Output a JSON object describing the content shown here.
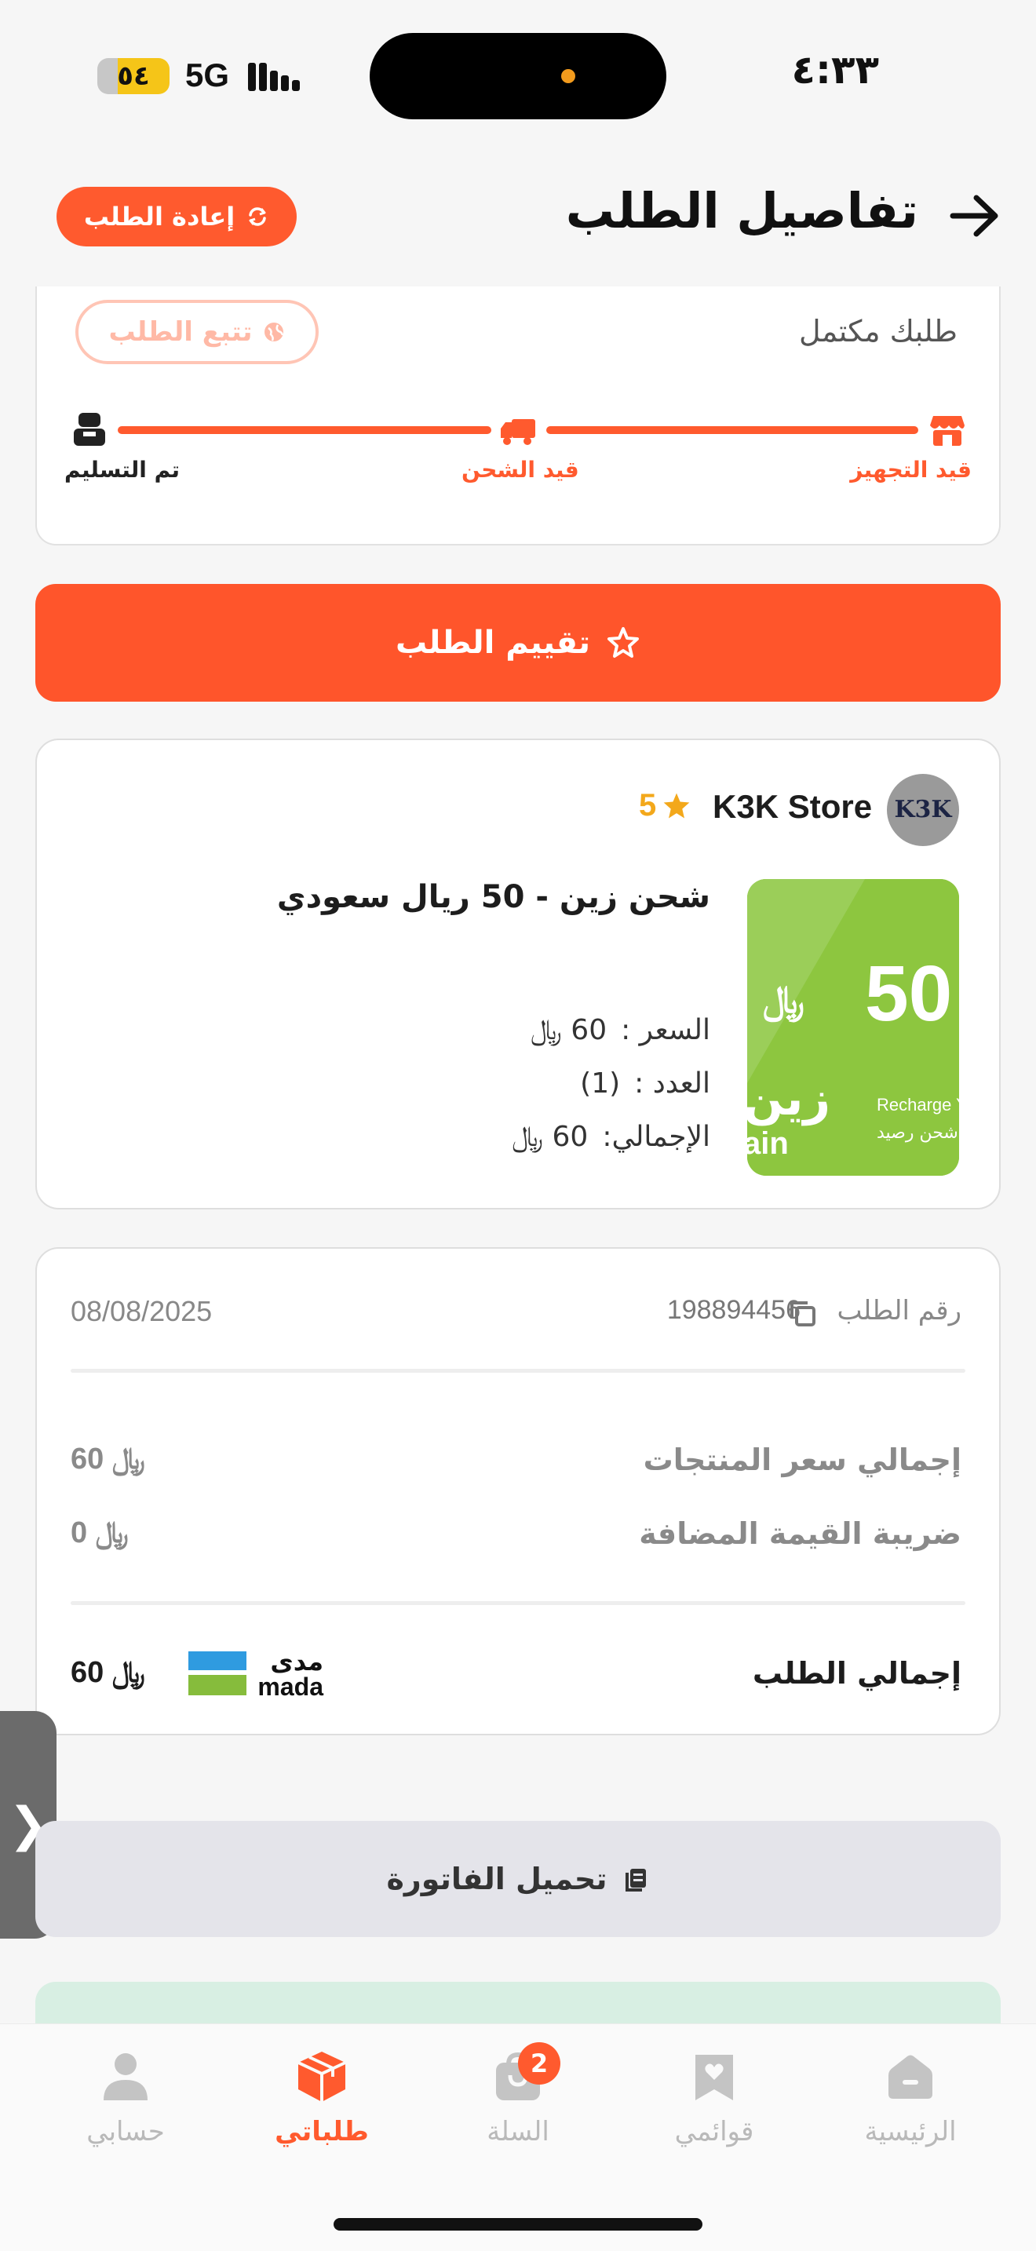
{
  "status_bar": {
    "time": "٤:٣٣",
    "network": "5G",
    "battery": "٥٤"
  },
  "header": {
    "title": "تفاصيل الطلب",
    "reorder_label": "إعادة الطلب"
  },
  "order_status": {
    "text": "طلبك مكتمل",
    "track_label": "تتبع الطلب",
    "steps": [
      {
        "label": "قيد التجهيز",
        "icon": "store-icon"
      },
      {
        "label": "قيد الشحن",
        "icon": "truck-icon"
      },
      {
        "label": "تم التسليم",
        "icon": "delivery-person-icon"
      }
    ]
  },
  "rate_label": "تقييم الطلب",
  "store": {
    "name": "K3K Store",
    "rating": "5",
    "logo_text": "K3K"
  },
  "product": {
    "name": "شحن زين - 50 ريال سعودي",
    "image_amount": "50",
    "image_brand_ar": "زين",
    "image_brand_en": "ain",
    "image_caption_en": "Recharge You",
    "image_caption_ar": "ة شحن رصيد",
    "price_label": "السعر :",
    "price_value": "60",
    "qty_label": "العدد :",
    "qty_value": "(1)",
    "total_label": "الإجمالي:",
    "total_value": "60"
  },
  "summary": {
    "order_number_label": "رقم الطلب",
    "order_number": "198894456",
    "date": "08/08/2025",
    "subtotal_label": "إجمالي سعر المنتجات",
    "subtotal_value": "60",
    "vat_label": "ضريبة القيمة المضافة",
    "vat_value": "0",
    "total_label": "إجمالي الطلب",
    "total_value": "60",
    "payment_ar": "مدى",
    "payment_en": "mada"
  },
  "invoice_label": "تحميل الفاتورة",
  "side_handle_glyph": "❯",
  "nav": {
    "home": "الرئيسية",
    "lists": "قوائمي",
    "cart": "السلة",
    "orders": "طلباتي",
    "account": "حسابي",
    "cart_badge": "2"
  },
  "colors": {
    "accent": "#ff5a2e",
    "rating_star": "#f3a81b",
    "mada_blue": "#2f9be0",
    "mada_green": "#86bc3c"
  }
}
